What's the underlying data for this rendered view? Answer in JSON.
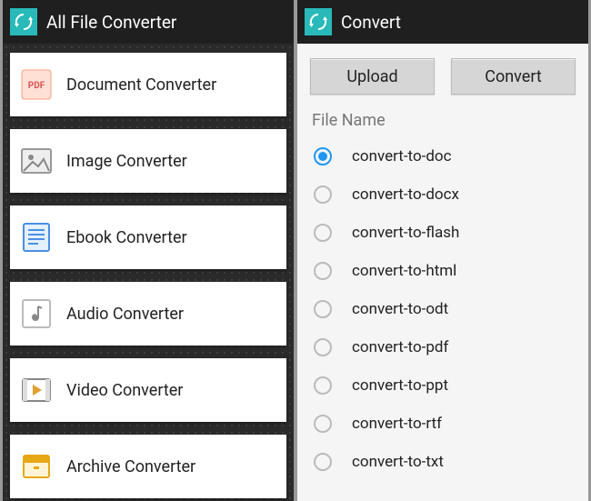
{
  "left": {
    "title": "All File Converter",
    "items": [
      {
        "label": "Document Converter",
        "icon": "pdf-icon"
      },
      {
        "label": "Image Converter",
        "icon": "image-icon"
      },
      {
        "label": "Ebook Converter",
        "icon": "ebook-icon"
      },
      {
        "label": "Audio Converter",
        "icon": "audio-icon"
      },
      {
        "label": "Video Converter",
        "icon": "video-icon"
      },
      {
        "label": "Archive Converter",
        "icon": "archive-icon"
      }
    ]
  },
  "right": {
    "title": "Convert",
    "upload_label": "Upload",
    "convert_label": "Convert",
    "section_label": "File Name",
    "options": [
      {
        "label": "convert-to-doc",
        "selected": true
      },
      {
        "label": "convert-to-docx",
        "selected": false
      },
      {
        "label": "convert-to-flash",
        "selected": false
      },
      {
        "label": "convert-to-html",
        "selected": false
      },
      {
        "label": "convert-to-odt",
        "selected": false
      },
      {
        "label": "convert-to-pdf",
        "selected": false
      },
      {
        "label": "convert-to-ppt",
        "selected": false
      },
      {
        "label": "convert-to-rtf",
        "selected": false
      },
      {
        "label": "convert-to-txt",
        "selected": false
      }
    ]
  }
}
